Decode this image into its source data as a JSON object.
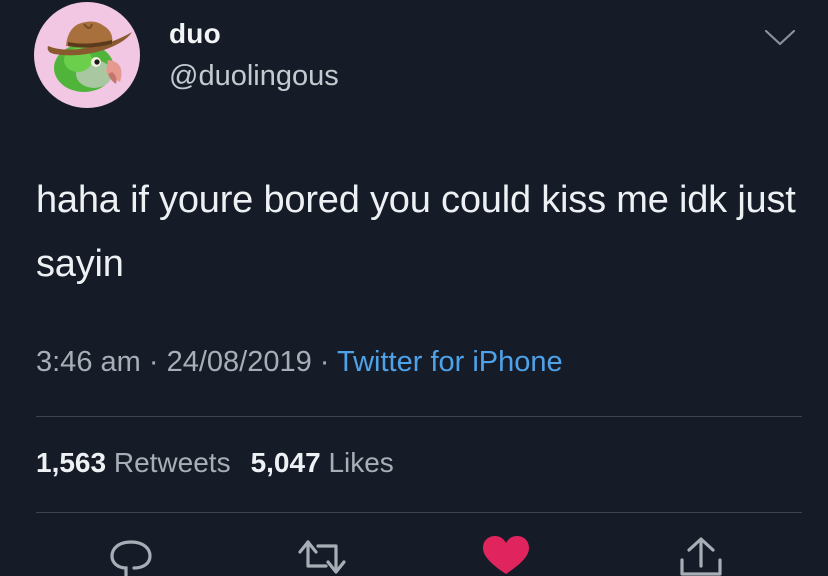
{
  "user": {
    "display_name": "duo",
    "handle": "@duolingous",
    "avatar_icon": "parrot-with-cowboy-hat"
  },
  "tweet": {
    "text": "haha if youre bored you could kiss me idk just sayin",
    "time": "3:46 am",
    "date": "24/08/2019",
    "separator": " · ",
    "source": "Twitter for iPhone"
  },
  "stats": {
    "retweets_count": "1,563",
    "retweets_label": "Retweets",
    "likes_count": "5,047",
    "likes_label": "Likes"
  },
  "actions": [
    {
      "name": "reply",
      "icon": "reply-icon"
    },
    {
      "name": "retweet",
      "icon": "retweet-icon"
    },
    {
      "name": "like",
      "icon": "heart-icon",
      "active": true
    },
    {
      "name": "share",
      "icon": "share-icon"
    }
  ],
  "colors": {
    "background": "#161c27",
    "text_primary": "#eef1f4",
    "text_secondary": "#a7aeb6",
    "link": "#4ea2e9",
    "like_active": "#e0245e",
    "avatar_bg": "#f1c7e4"
  }
}
